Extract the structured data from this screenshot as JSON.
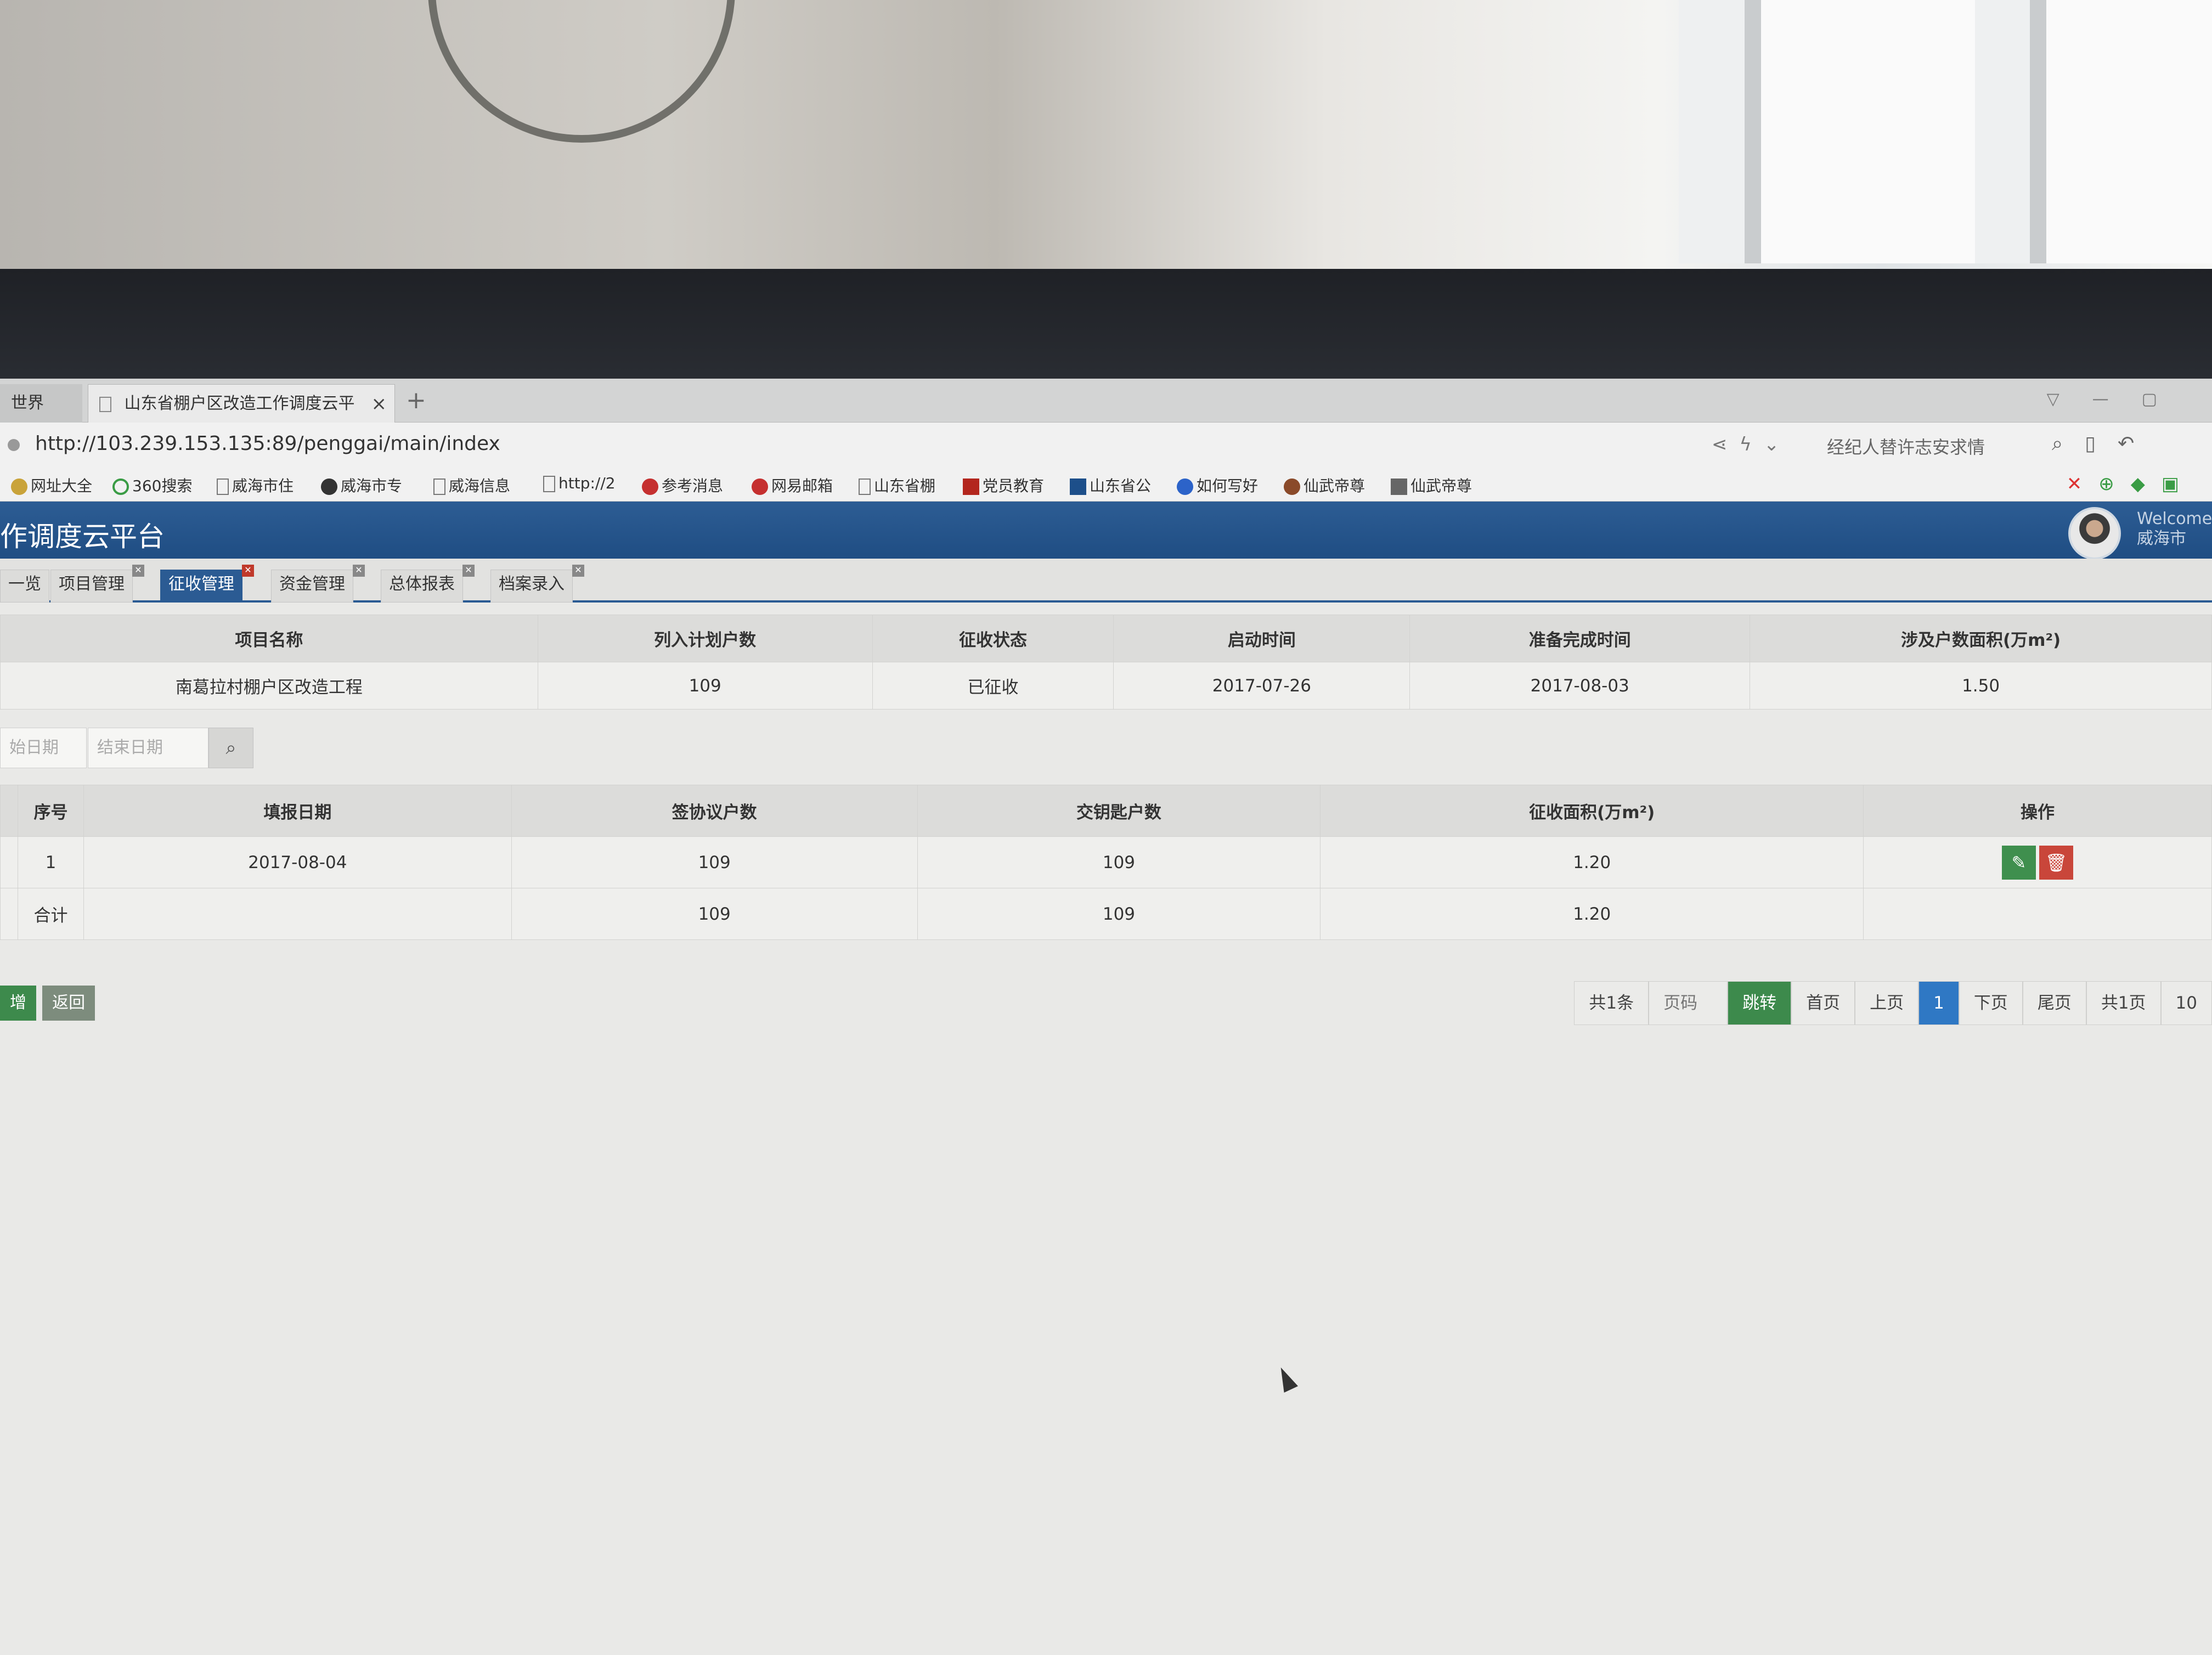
{
  "browser": {
    "left_tab": "世界",
    "active_tab": "山东省棚户区改造工作调度云平",
    "close_glyph": "×",
    "new_tab_glyph": "+",
    "url": "http://103.239.153.135:89/penggai/main/index",
    "search_text": "经纪人替许志安求情",
    "bookmarks": [
      "网址大全",
      "360搜索",
      "威海市住",
      "威海市专",
      "威海信息",
      "http://2",
      "参考消息",
      "网易邮箱",
      "山东省棚",
      "党员教育",
      "山东省公",
      "如何写好",
      "仙武帝尊",
      "仙武帝尊"
    ]
  },
  "app": {
    "title": "作调度云平台",
    "welcome": "Welcome",
    "user_city": "威海市"
  },
  "module_tabs": [
    {
      "label": "一览",
      "active": false
    },
    {
      "label": "项目管理",
      "active": false
    },
    {
      "label": "征收管理",
      "active": true
    },
    {
      "label": "资金管理",
      "active": false
    },
    {
      "label": "总体报表",
      "active": false
    },
    {
      "label": "档案录入",
      "active": false
    }
  ],
  "tab_close_glyph": "✕",
  "project_info": {
    "headers": [
      "项目名称",
      "列入计划户数",
      "征收状态",
      "启动时间",
      "准备完成时间",
      "涉及户数面积(万m²)"
    ],
    "row": [
      "南葛拉村棚户区改造工程",
      "109",
      "已征收",
      "2017-07-26",
      "2017-08-03",
      "1.50"
    ]
  },
  "filter": {
    "start_placeholder": "始日期",
    "end_placeholder": "结束日期",
    "search_glyph": "⌕"
  },
  "records": {
    "headers": [
      "序号",
      "填报日期",
      "签协议户数",
      "交钥匙户数",
      "征收面积(万m²)",
      "操作"
    ],
    "rows": [
      {
        "no": "1",
        "date": "2017-08-04",
        "signed": "109",
        "keys": "109",
        "area": "1.20"
      }
    ],
    "total": {
      "label": "合计",
      "signed": "109",
      "keys": "109",
      "area": "1.20"
    },
    "edit_glyph": "✎",
    "delete_glyph": "🗑"
  },
  "actions": {
    "add": "增",
    "back": "返回"
  },
  "pager": {
    "total": "共1条",
    "page_placeholder": "页码",
    "jump": "跳转",
    "first": "首页",
    "prev": "上页",
    "current": "1",
    "next": "下页",
    "last": "尾页",
    "pages": "共1页",
    "size": "10"
  },
  "colors": {
    "header_blue": "#1f4d83",
    "active_tab": "#2b5b93",
    "green": "#3d8a4c",
    "red": "#c9463a",
    "page_current": "#2f78c4"
  }
}
